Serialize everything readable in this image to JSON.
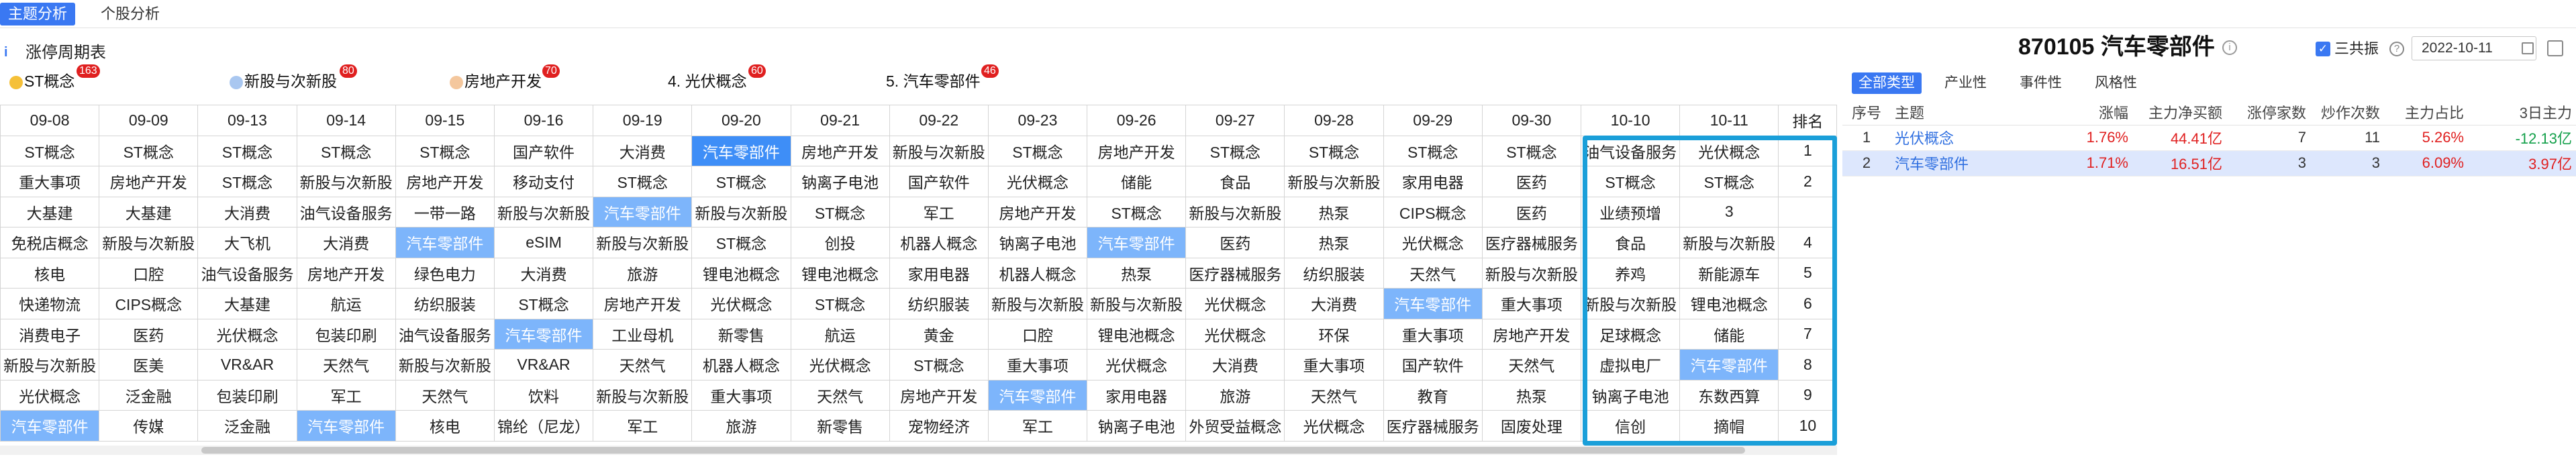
{
  "top_tabs": [
    "主题分析",
    "个股分析"
  ],
  "left_title": "涨停周期表",
  "rankings": [
    {
      "label": "ST概念",
      "count": "163",
      "dot_color": "#f5c038"
    },
    {
      "label": "新股与次新股",
      "count": "80",
      "dot_color": "#a9c7f0"
    },
    {
      "label": "房地产开发",
      "count": "70",
      "dot_color": "#f4c79d"
    },
    {
      "label": "4. 光伏概念",
      "count": "60"
    },
    {
      "label": "5. 汽车零部件",
      "count": "46"
    }
  ],
  "dates": [
    "09-08",
    "09-09",
    "09-13",
    "09-14",
    "09-15",
    "09-16",
    "09-19",
    "09-20",
    "09-21",
    "09-22",
    "09-23",
    "09-26",
    "09-27",
    "09-28",
    "09-29",
    "09-30",
    "10-10",
    "10-11"
  ],
  "rank_header": "排名",
  "grid_rows": [
    [
      "ST概念",
      "ST概念",
      "ST概念",
      "ST概念",
      "ST概念",
      "国产软件",
      "大消费",
      "汽车零部件",
      "房地产开发",
      "新股与次新股",
      "ST概念",
      "房地产开发",
      "ST概念",
      "ST概念",
      "ST概念",
      "ST概念",
      "油气设备服务",
      "光伏概念",
      "1"
    ],
    [
      "重大事项",
      "房地产开发",
      "ST概念",
      "新股与次新股",
      "房地产开发",
      "移动支付",
      "ST概念",
      "ST概念",
      "钠离子电池",
      "国产软件",
      "光伏概念",
      "储能",
      "食品",
      "新股与次新股",
      "家用电器",
      "医药",
      "ST概念",
      "ST概念",
      "2"
    ],
    [
      "大基建",
      "大基建",
      "大消费",
      "油气设备服务",
      "一带一路",
      "新股与次新股",
      "汽车零部件",
      "新股与次新股",
      "ST概念",
      "军工",
      "房地产开发",
      "ST概念",
      "新股与次新股",
      "热泵",
      "CIPS概念",
      "医药",
      "业绩预增",
      "3"
    ],
    [
      "免税店概念",
      "新股与次新股",
      "大飞机",
      "大消费",
      "汽车零部件",
      "eSIM",
      "新股与次新股",
      "ST概念",
      "创投",
      "机器人概念",
      "钠离子电池",
      "汽车零部件",
      "医药",
      "热泵",
      "光伏概念",
      "医疗器械服务",
      "食品",
      "新股与次新股",
      "4"
    ],
    [
      "核电",
      "口腔",
      "油气设备服务",
      "房地产开发",
      "绿色电力",
      "大消费",
      "旅游",
      "锂电池概念",
      "锂电池概念",
      "家用电器",
      "机器人概念",
      "热泵",
      "医疗器械服务",
      "纺织服装",
      "天然气",
      "新股与次新股",
      "养鸡",
      "新能源车",
      "5"
    ],
    [
      "快递物流",
      "CIPS概念",
      "大基建",
      "航运",
      "纺织服装",
      "ST概念",
      "房地产开发",
      "光伏概念",
      "ST概念",
      "纺织服装",
      "新股与次新股",
      "新股与次新股",
      "光伏概念",
      "大消费",
      "汽车零部件",
      "重大事项",
      "新股与次新股",
      "锂电池概念",
      "6"
    ],
    [
      "消费电子",
      "医药",
      "光伏概念",
      "包装印刷",
      "油气设备服务",
      "汽车零部件",
      "工业母机",
      "新零售",
      "航运",
      "黄金",
      "口腔",
      "锂电池概念",
      "光伏概念",
      "环保",
      "重大事项",
      "房地产开发",
      "足球概念",
      "储能",
      "7"
    ],
    [
      "新股与次新股",
      "医美",
      "VR&AR",
      "天然气",
      "新股与次新股",
      "VR&AR",
      "天然气",
      "机器人概念",
      "光伏概念",
      "ST概念",
      "重大事项",
      "光伏概念",
      "大消费",
      "重大事项",
      "国产软件",
      "天然气",
      "虚拟电厂",
      "汽车零部件",
      "8"
    ],
    [
      "光伏概念",
      "泛金融",
      "包装印刷",
      "军工",
      "天然气",
      "饮料",
      "新股与次新股",
      "重大事项",
      "天然气",
      "房地产开发",
      "汽车零部件",
      "家用电器",
      "旅游",
      "天然气",
      "教育",
      "热泵",
      "钠离子电池",
      "东数西算",
      "9"
    ],
    [
      "汽车零部件",
      "传媒",
      "泛金融",
      "汽车零部件",
      "核电",
      "锦纶（尼龙）",
      "军工",
      "旅游",
      "新零售",
      "宠物经济",
      "军工",
      "钠离子电池",
      "外贸受益概念",
      "光伏概念",
      "医疗器械服务",
      "固废处理",
      "信创",
      "摘帽",
      "10"
    ]
  ],
  "stock": {
    "code": "870105",
    "name": "汽车零部件"
  },
  "sanji_label": "三共振",
  "date_value": "2022-10-11",
  "type_tabs": [
    "全部类型",
    "产业性",
    "事件性",
    "风格性"
  ],
  "right_table": {
    "headers": [
      "序号",
      "主题",
      "涨幅",
      "主力净买额",
      "涨停家数",
      "炒作次数",
      "主力占比",
      "3日主力"
    ],
    "rows": [
      [
        "1",
        "光伏概念",
        "1.76%",
        "44.41亿",
        "7",
        "11",
        "5.26%",
        "-12.13亿"
      ],
      [
        "2",
        "汽车零部件",
        "1.71%",
        "16.51亿",
        "3",
        "3",
        "6.09%",
        "3.97亿"
      ]
    ]
  }
}
